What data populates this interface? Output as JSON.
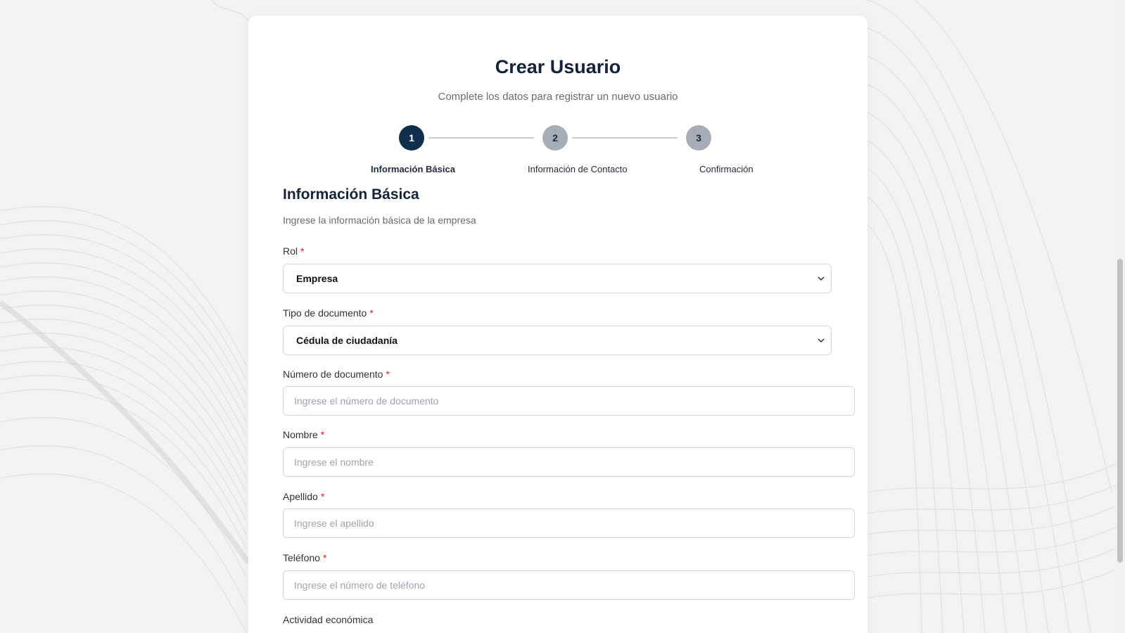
{
  "header": {
    "title": "Crear Usuario",
    "subtitle": "Complete los datos para registrar un nuevo usuario"
  },
  "stepper": {
    "steps": [
      {
        "number": "1",
        "label": "Información Básica",
        "state": "active"
      },
      {
        "number": "2",
        "label": "Información de Contacto",
        "state": "inactive"
      },
      {
        "number": "3",
        "label": "Confirmación",
        "state": "inactive"
      }
    ]
  },
  "section": {
    "title": "Información Básica",
    "description": "Ingrese la información básica de la empresa"
  },
  "form": {
    "required_mark": "*",
    "rol": {
      "label": "Rol",
      "value": "Empresa"
    },
    "tipo_documento": {
      "label": "Tipo de documento",
      "value": "Cédula de ciudadanía"
    },
    "numero_documento": {
      "label": "Número de documento",
      "placeholder": "Ingrese el número de documento"
    },
    "nombre": {
      "label": "Nombre",
      "placeholder": "Ingrese el nombre"
    },
    "apellido": {
      "label": "Apellido",
      "placeholder": "Ingrese el apellido"
    },
    "telefono": {
      "label": "Teléfono",
      "placeholder": "Ingrese el número de teléfono"
    },
    "actividad_economica": {
      "label": "Actividad económica"
    }
  },
  "colors": {
    "primary": "#0f2f4d",
    "inactive_step": "#a7adb6",
    "required": "#d62020",
    "title": "#14233a"
  },
  "icons": {
    "select_chevron": "chevron-down-icon"
  }
}
